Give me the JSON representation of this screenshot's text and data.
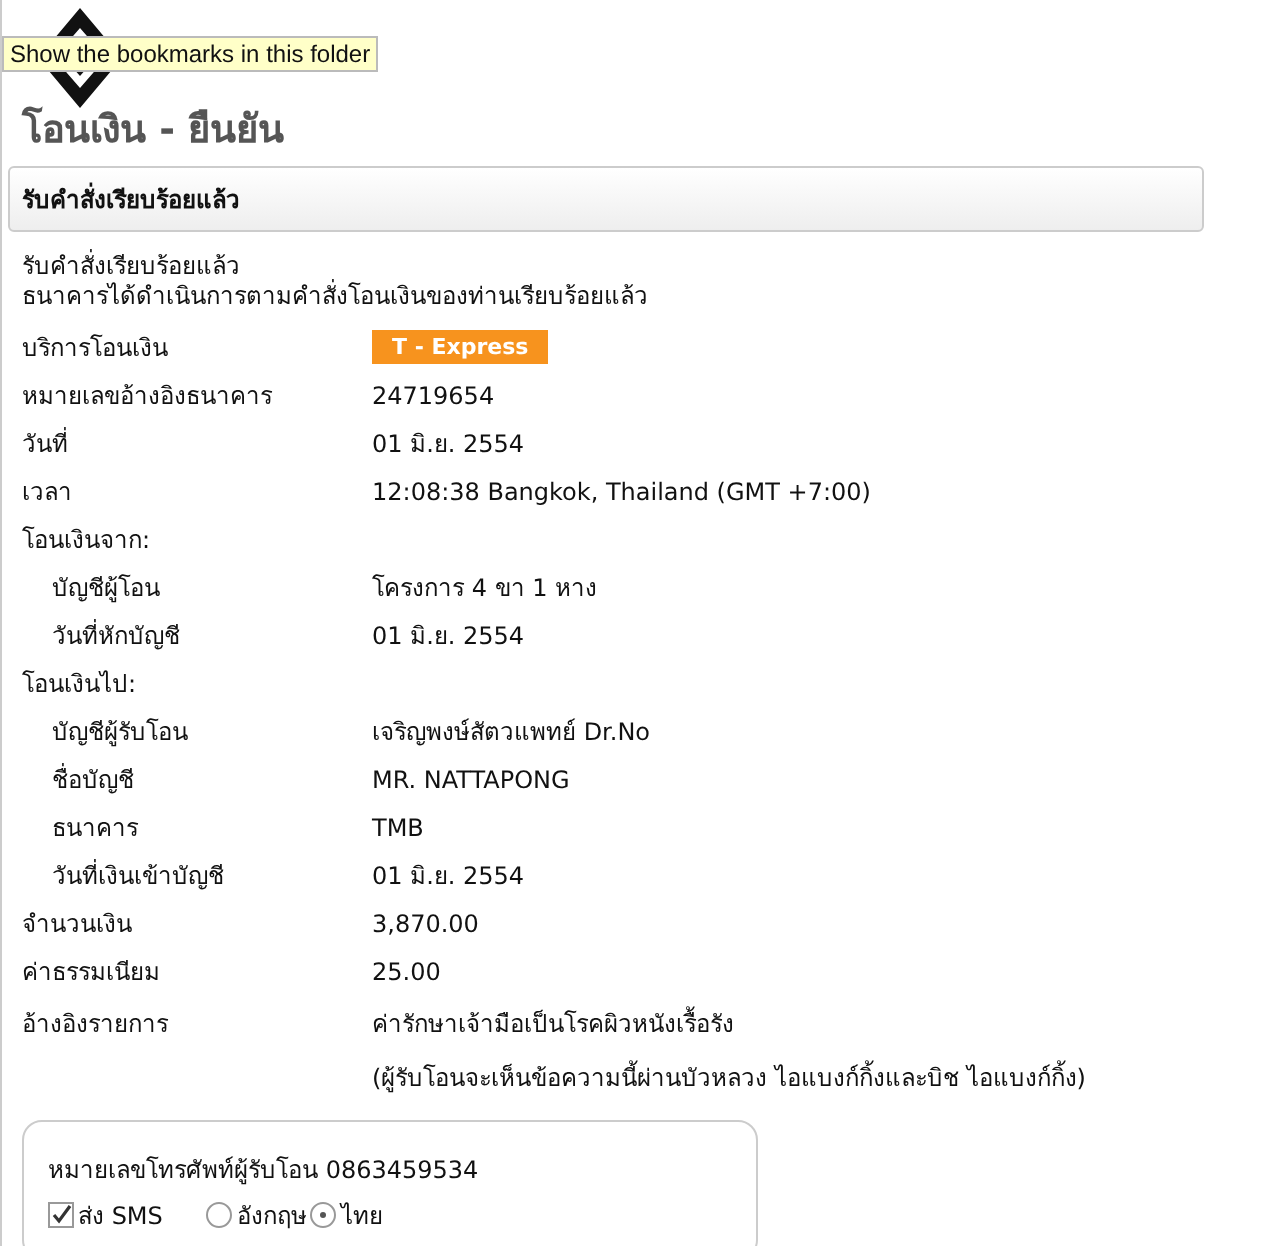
{
  "tooltip": "Show the bookmarks in this folder",
  "page_title": "โอนเงิน - ยืนยัน",
  "panel_title": "รับคำสั่งเรียบร้อยแล้ว",
  "messages": [
    "รับคำสั่งเรียบร้อยแล้ว",
    "ธนาคารได้ดำเนินการตามคำสั่งโอนเงินของท่านเรียบร้อยแล้ว"
  ],
  "details": [
    {
      "kind": "badge",
      "label": "บริการโอนเงิน",
      "value": "T - Express"
    },
    {
      "kind": "text",
      "label": "หมายเลขอ้างอิงธนาคาร",
      "value": "24719654"
    },
    {
      "kind": "text",
      "label": "วันที่",
      "value": "01 มิ.ย. 2554"
    },
    {
      "kind": "text",
      "label": "เวลา",
      "value": "12:08:38 Bangkok, Thailand (GMT +7:00)"
    },
    {
      "kind": "group",
      "label": "โอนเงินจาก:",
      "children": [
        {
          "kind": "text",
          "label": "บัญชีผู้โอน",
          "value": "โครงการ 4 ขา 1 หาง"
        },
        {
          "kind": "text",
          "label": "วันที่หักบัญชี",
          "value": "01 มิ.ย. 2554"
        }
      ]
    },
    {
      "kind": "group",
      "label": "โอนเงินไป:",
      "children": [
        {
          "kind": "text",
          "label": "บัญชีผู้รับโอน",
          "value": "เจริญพงษ์สัตวแพทย์ Dr.No"
        },
        {
          "kind": "text",
          "label": "ชื่อบัญชี",
          "value": "MR. NATTAPONG"
        },
        {
          "kind": "text",
          "label": "ธนาคาร",
          "value": "TMB"
        },
        {
          "kind": "text",
          "label": "วันที่เงินเข้าบัญชี",
          "value": "01 มิ.ย. 2554"
        }
      ]
    },
    {
      "kind": "text",
      "label": "จำนวนเงิน",
      "value": "3,870.00"
    },
    {
      "kind": "text",
      "label": "ค่าธรรมเนียม",
      "value": "25.00"
    },
    {
      "kind": "multi",
      "label": "อ้างอิงรายการ",
      "lines": [
        "ค่ารักษาเจ้ามือเป็นโรคผิวหนังเรื้อรัง",
        "(ผู้รับโอนจะเห็นข้อความนี้ผ่านบัวหลวง ไอแบงก์กิ้งและบิช ไอแบงก์กิ้ง)"
      ]
    }
  ],
  "sms_box": {
    "phone_text": "หมายเลขโทรศัพท์ผู้รับโอน 0863459534",
    "send_sms": {
      "label": "ส่ง SMS",
      "checked": true
    },
    "languages": [
      {
        "label": "อังกฤษ",
        "selected": false
      },
      {
        "label": "ไทย",
        "selected": true
      }
    ]
  }
}
